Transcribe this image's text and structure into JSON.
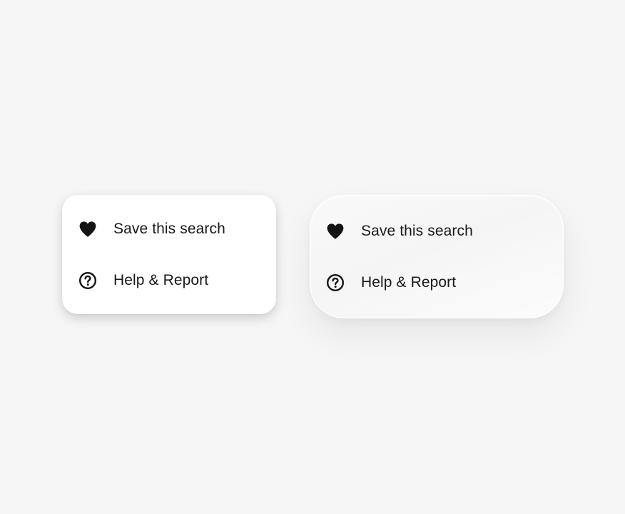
{
  "background_color": "#f6f6f6",
  "menus": [
    {
      "style": "flat-card",
      "items": [
        {
          "icon": "heart-icon",
          "label": "Save this search"
        },
        {
          "icon": "help-circle-icon",
          "label": "Help & Report"
        }
      ]
    },
    {
      "style": "soft-glass",
      "items": [
        {
          "icon": "heart-icon",
          "label": "Save this search"
        },
        {
          "icon": "help-circle-icon",
          "label": "Help & Report"
        }
      ]
    }
  ]
}
